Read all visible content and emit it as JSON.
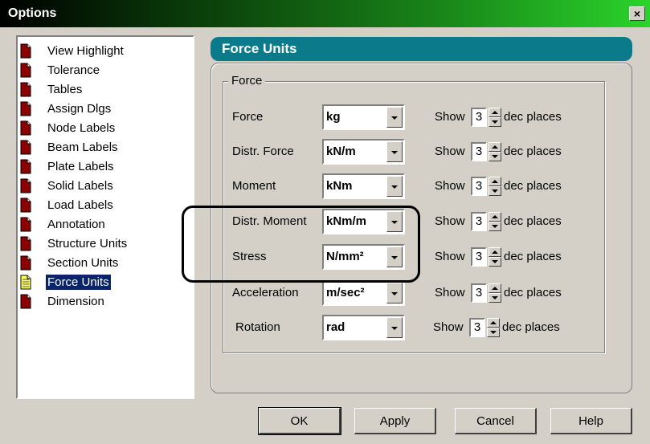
{
  "window": {
    "title": "Options",
    "close_label": "×"
  },
  "tree": {
    "items": [
      {
        "label": "View Highlight",
        "selected": false
      },
      {
        "label": "Tolerance",
        "selected": false
      },
      {
        "label": "Tables",
        "selected": false
      },
      {
        "label": "Assign Dlgs",
        "selected": false
      },
      {
        "label": "Node Labels",
        "selected": false
      },
      {
        "label": "Beam Labels",
        "selected": false
      },
      {
        "label": "Plate Labels",
        "selected": false
      },
      {
        "label": "Solid Labels",
        "selected": false
      },
      {
        "label": "Load Labels",
        "selected": false
      },
      {
        "label": "Annotation",
        "selected": false
      },
      {
        "label": "Structure Units",
        "selected": false
      },
      {
        "label": "Section Units",
        "selected": false
      },
      {
        "label": "Force Units",
        "selected": true
      },
      {
        "label": "Dimension",
        "selected": false
      }
    ],
    "icon": "page-icon",
    "selected_icon": "open-page-icon"
  },
  "panel": {
    "title": "Force Units",
    "group_label": "Force",
    "rows": [
      {
        "label": "Force",
        "unit": "kg",
        "show": "Show",
        "decimals": "3",
        "suffix": "dec places"
      },
      {
        "label": "Distr. Force",
        "unit": "kN/m",
        "show": "Show",
        "decimals": "3",
        "suffix": "dec places"
      },
      {
        "label": "Moment",
        "unit": "kNm",
        "show": "Show",
        "decimals": "3",
        "suffix": "dec places"
      },
      {
        "label": "Distr. Moment",
        "unit": "kNm/m",
        "show": "Show",
        "decimals": "3",
        "suffix": "dec places"
      },
      {
        "label": "Stress",
        "unit": "N/mm²",
        "show": "Show",
        "decimals": "3",
        "suffix": "dec places"
      },
      {
        "label": "Acceleration",
        "unit": "m/sec²",
        "show": "Show",
        "decimals": "3",
        "suffix": "dec places"
      },
      {
        "label": "Rotation",
        "unit": "rad",
        "show": "Show",
        "decimals": "3",
        "suffix": "dec places"
      }
    ]
  },
  "buttons": {
    "ok": "OK",
    "apply": "Apply",
    "cancel": "Cancel",
    "help": "Help"
  },
  "colors": {
    "header_teal": "#0b7b8b",
    "selection": "#0a246a",
    "page_icon_red": "#8b0000",
    "selected_icon_yellow": "#ffff66"
  }
}
